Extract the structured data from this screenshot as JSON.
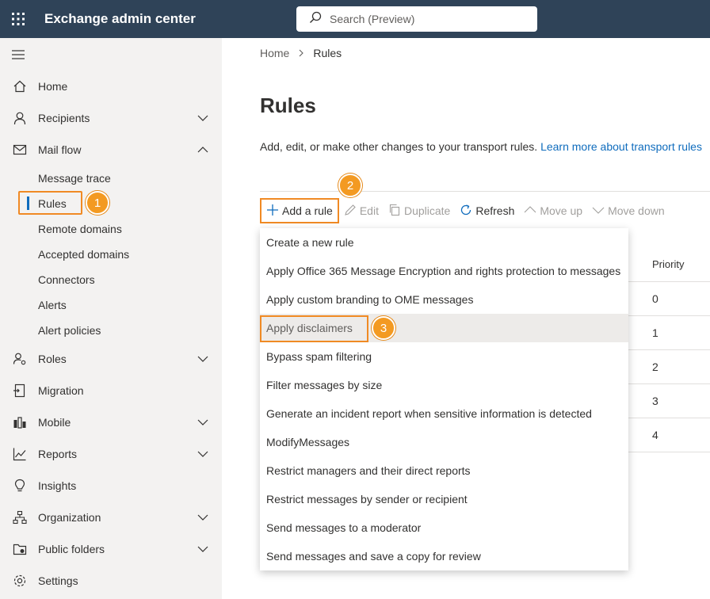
{
  "app": {
    "title": "Exchange admin center"
  },
  "search": {
    "placeholder": "Search (Preview)"
  },
  "sidebar": {
    "items": [
      {
        "label": "Home"
      },
      {
        "label": "Recipients"
      },
      {
        "label": "Mail flow"
      },
      {
        "label": "Roles"
      },
      {
        "label": "Migration"
      },
      {
        "label": "Mobile"
      },
      {
        "label": "Reports"
      },
      {
        "label": "Insights"
      },
      {
        "label": "Organization"
      },
      {
        "label": "Public folders"
      },
      {
        "label": "Settings"
      }
    ],
    "mailflow_sub": [
      {
        "label": "Message trace"
      },
      {
        "label": "Rules"
      },
      {
        "label": "Remote domains"
      },
      {
        "label": "Accepted domains"
      },
      {
        "label": "Connectors"
      },
      {
        "label": "Alerts"
      },
      {
        "label": "Alert policies"
      }
    ]
  },
  "callouts": [
    "1",
    "2",
    "3"
  ],
  "breadcrumb": {
    "home": "Home",
    "current": "Rules"
  },
  "page": {
    "title": "Rules",
    "description": "Add, edit, or make other changes to your transport rules.",
    "learn_more": "Learn more about transport rules"
  },
  "toolbar": {
    "add": "Add a rule",
    "edit": "Edit",
    "duplicate": "Duplicate",
    "refresh": "Refresh",
    "move_up": "Move up",
    "move_down": "Move down"
  },
  "table": {
    "priority_header": "Priority",
    "priorities": [
      "0",
      "1",
      "2",
      "3",
      "4"
    ]
  },
  "menu": {
    "items": [
      "Create a new rule",
      "Apply Office 365 Message Encryption and rights protection to messages",
      "Apply custom branding to OME messages",
      "Apply disclaimers",
      "Bypass spam filtering",
      "Filter messages by size",
      "Generate an incident report when sensitive information is detected",
      "ModifyMessages",
      "Restrict managers and their direct reports",
      "Restrict messages by sender or recipient",
      "Send messages to a moderator",
      "Send messages and save a copy for review"
    ],
    "highlighted_index": 3
  },
  "colors": {
    "topbar": "#2f4358",
    "accent": "#0f6cbd",
    "callout": "#f39a22"
  }
}
